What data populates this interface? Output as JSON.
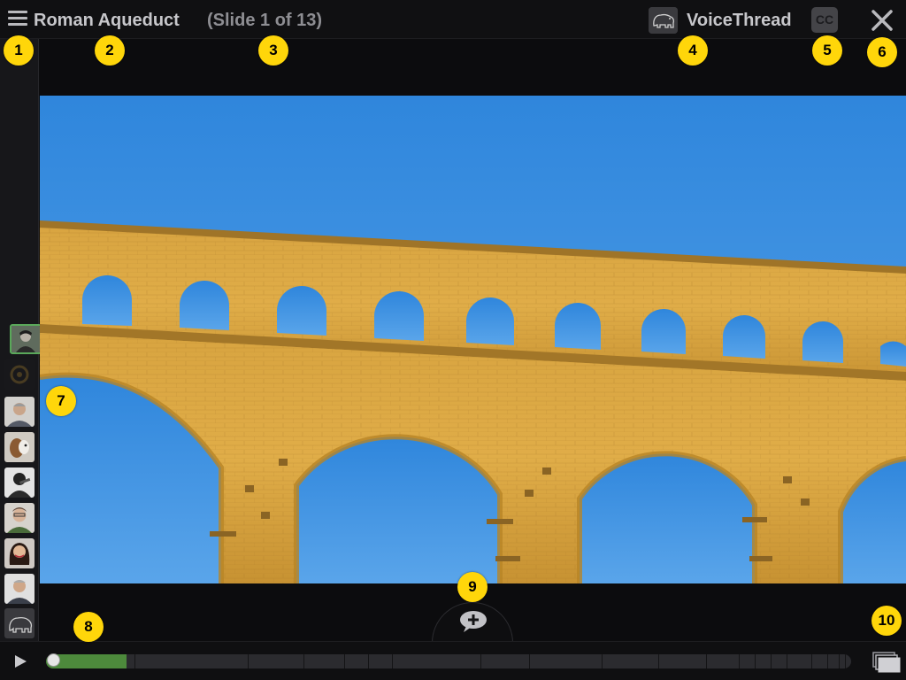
{
  "header": {
    "title": "Roman Aqueduct",
    "slide_counter": "(Slide 1 of 13)",
    "brand_name": "VoiceThread",
    "cc_label": "CC"
  },
  "sidebar": {
    "avatars": [
      {
        "name": "commenter-1",
        "active": true
      },
      {
        "name": "commenter-2",
        "active": false
      },
      {
        "name": "commenter-3",
        "active": false
      },
      {
        "name": "commenter-4",
        "active": false
      },
      {
        "name": "commenter-5",
        "active": false
      },
      {
        "name": "commenter-6",
        "active": false
      },
      {
        "name": "commenter-7",
        "active": false
      },
      {
        "name": "commenter-8",
        "active": false
      },
      {
        "name": "commenter-9",
        "active": false
      }
    ]
  },
  "timeline": {
    "progress_fraction": 0.1,
    "segment_count": 20
  },
  "markers": [
    "1",
    "2",
    "3",
    "4",
    "5",
    "6",
    "7",
    "8",
    "9",
    "10"
  ],
  "icons": {
    "menu": "hamburger-menu-icon",
    "close": "close-icon",
    "play": "play-icon",
    "add_comment": "add-comment-icon",
    "slides": "slides-stack-icon"
  },
  "colors": {
    "accent_green": "#4d8a3c",
    "marker_yellow": "#ffd60a",
    "sky_blue": "#3c8fdc",
    "stone": "#d9a53a"
  }
}
